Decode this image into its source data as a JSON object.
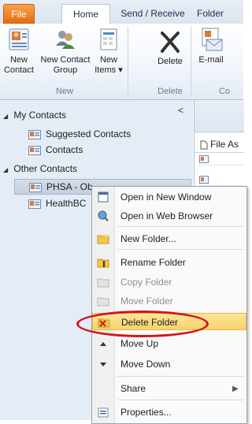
{
  "tabs": {
    "file": "File",
    "home": "Home",
    "send_receive": "Send / Receive",
    "folder": "Folder"
  },
  "ribbon": {
    "new_group": {
      "label": "New",
      "new_contact": [
        "New",
        "Contact"
      ],
      "new_contact_group": [
        "New Contact",
        "Group"
      ],
      "new_items": [
        "New",
        "Items ▾"
      ]
    },
    "delete_group": {
      "label": "Delete",
      "delete": "Delete"
    },
    "communicate_group": {
      "label": "Co",
      "email": "E-mail"
    }
  },
  "nav": {
    "collapse_glyph": "<",
    "my_contacts": "My Contacts",
    "my_items": [
      "Suggested Contacts",
      "Contacts"
    ],
    "other_contacts": "Other Contacts",
    "other_items": [
      "PHSA - Ob",
      "HealthBC"
    ]
  },
  "content": {
    "column_header": "File As"
  },
  "context_menu": {
    "items": [
      "Open in New Window",
      "Open in Web Browser",
      "New Folder...",
      "Rename Folder",
      "Copy Folder",
      "Move Folder",
      "Delete Folder",
      "Move Up",
      "Move Down",
      "Share",
      "Properties..."
    ]
  },
  "colors": {
    "file_tab": "#e36d12",
    "nav_bg": "#e4ecf6",
    "menu_highlight": "#f7d46b",
    "annotation_ring": "#d4131b"
  }
}
